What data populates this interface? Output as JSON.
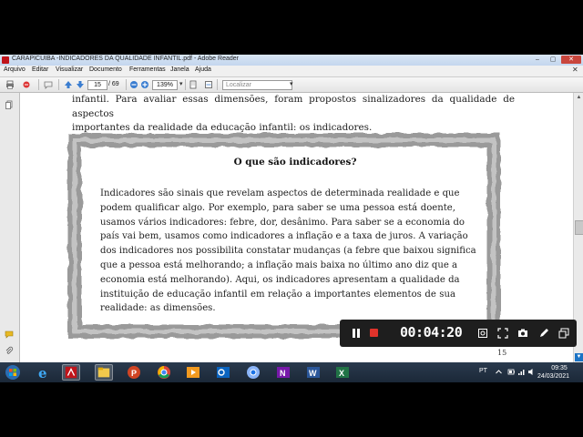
{
  "window": {
    "title": "CARAPICUIBA -INDICADORES DA QUALIDADE INFANTIL.pdf - Adobe Reader",
    "minimize": "–",
    "maximize": "▢",
    "close": "✕"
  },
  "menubar": {
    "items": [
      "Arquivo",
      "Editar",
      "Visualizar",
      "Documento",
      "Ferramentas",
      "Janela",
      "Ajuda"
    ],
    "close_doc": "✕"
  },
  "toolbar": {
    "current_page": "15",
    "page_total": "/ 69",
    "zoom": "139%",
    "search_placeholder": "Localizar"
  },
  "document": {
    "intro_lines": [
      "infantil. Para avaliar essas dimensões, foram propostos sinalizadores da qualidade de aspectos",
      "importantes da realidade da educação infantil: os indicadores."
    ],
    "box_title": "O que são indicadores?",
    "box_lines": [
      "Indicadores são sinais que revelam aspectos de determinada realidade e que",
      "podem qualificar algo. Por exemplo, para saber se uma pessoa está doente,",
      "usamos vários indicadores: febre, dor, desânimo. Para saber se a economia do",
      "país vai bem, usamos como indicadores a inflação e a taxa de juros. A variação",
      "dos indicadores nos possibilita constatar mudanças (a febre que baixou significa",
      "que a pessoa está melhorando; a inflação mais baixa no último ano diz que a",
      "economia está melhorando). Aqui, os indicadores apresentam a qualidade da",
      "instituição de educação infantil em relação a importantes elementos de sua",
      "realidade: as dimensões."
    ],
    "page_number": "15"
  },
  "recorder": {
    "elapsed": "00:04:20"
  },
  "taskbar": {
    "apps": [
      "start",
      "internet-explorer",
      "adobe-reader",
      "file-explorer",
      "powerpoint-viewer",
      "chrome",
      "media-player",
      "outlook",
      "chrome-alt",
      "onenote",
      "word",
      "excel"
    ],
    "language": "PT",
    "time": "09:35",
    "date": "24/03/2021"
  },
  "colors": {
    "title_bar": "#c3d6ee",
    "adobe_red": "#c0151b",
    "recorder_bg": "#1e1e1e",
    "record_red": "#e0332b",
    "taskbar": "#1b2838"
  }
}
